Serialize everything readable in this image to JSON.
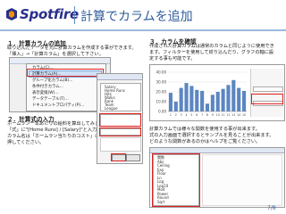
{
  "header": {
    "logo_text": "Spotfire",
    "title": "計算でカラムを追加"
  },
  "section1": {
    "title": "１．計算カラムの追加",
    "lines": [
      "取り込んだデータを元に計算カラムを作成する事ができます。",
      "「挿入」→「計算カラム」を選択して下さい。"
    ]
  },
  "section2": {
    "title": "２．計算式の入力",
    "lines": [
      "ホームラン一本あたりの給料を算出してみましょう。",
      "「式」に\"[Home Runs] / [Salary]\"と入力してください。",
      "カラム名は「ホームラン当たりのコスト」にし、「OK」を",
      "押してください。"
    ]
  },
  "section3": {
    "title": "３．カラムを確認",
    "lines": [
      "作成された計算カラムは通常のカラムと同じように使用でき",
      "ます。フィルターを使用して絞り込んだり、グラフの軸に設",
      "定する事も可能です。"
    ]
  },
  "note": {
    "lines": [
      "計算カラムでは様々な関数を使用する事が出来ます。",
      "式の入力画面で選択するとサンプルを見ることが出来ます。",
      "どのような関数があるのかはヘルプをご覧ください。"
    ]
  },
  "menu_items": [
    "カラム(C)...",
    "計算カラム(A)...",
    "グループ化カラム(B)...",
    "条件付きカラム...",
    "表示変換(W)...",
    "データテーブル(T)...",
    "ドキュメントプロパティ(P)..."
  ],
  "panel_rows": [
    "Salary",
    "Home Runs",
    "Hits",
    "Walks",
    "Rank",
    "Team",
    "League"
  ],
  "function_rows": [
    "関数",
    "Abs",
    "Ceiling",
    "Exp",
    "Floor",
    "Ln",
    "Log",
    "Log10",
    "Mod",
    "Power",
    "Round",
    "Sqrt"
  ],
  "chart_data": {
    "type": "bar",
    "categories": [
      "1",
      "2",
      "3",
      "4",
      "5",
      "6",
      "7",
      "8",
      "9",
      "10",
      "11",
      "12",
      "13",
      "14",
      "15"
    ],
    "values": [
      19,
      10,
      24,
      29,
      26,
      22,
      21,
      8,
      17,
      20,
      23,
      27,
      32,
      24,
      21
    ],
    "ylim": [
      0,
      40
    ],
    "yticks": [
      "40.00",
      "30.00",
      "20.00",
      "10.00",
      "0.00"
    ],
    "xlabel": "",
    "ylabel": "",
    "color": "#5b86c2"
  },
  "page_number": "7/8"
}
